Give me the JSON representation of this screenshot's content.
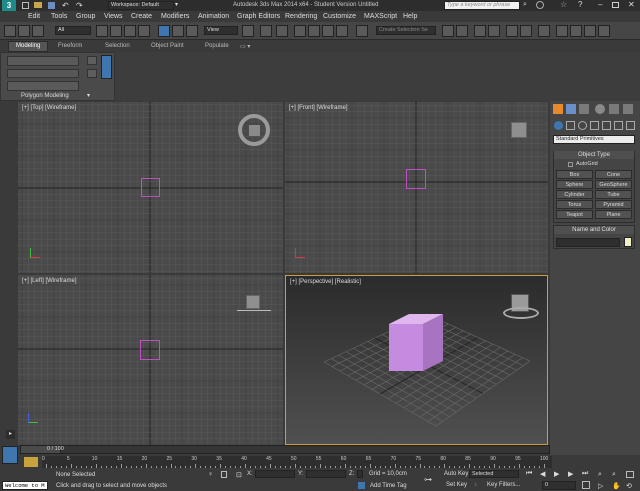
{
  "titlebar": {
    "workspace": "Workspace: Default",
    "title": "Autodesk 3ds Max 2014 x64  -  Student Version   Untitled",
    "search_placeholder": "Type a keyword or phrase"
  },
  "menu": [
    "Edit",
    "Tools",
    "Group",
    "Views",
    "Create",
    "Modifiers",
    "Animation",
    "Graph Editors",
    "Rendering",
    "Customize",
    "MAXScript",
    "Help"
  ],
  "toolbar": {
    "filter": "All",
    "ref_coord": "View",
    "selection_set": "Create Selection Se"
  },
  "ribbon": {
    "tabs": [
      "Modeling",
      "Freeform",
      "Selection",
      "Object Paint",
      "Populate"
    ],
    "active_tab": "Modeling",
    "panel_label": "Polygon Modeling"
  },
  "viewports": [
    {
      "label": "[+] [Top] [Wireframe]"
    },
    {
      "label": "[+] [Front] [Wireframe]"
    },
    {
      "label": "[+] [Left] [Wireframe]"
    },
    {
      "label": "[+] [Perspective] [Realistic]"
    }
  ],
  "command_panel": {
    "dropdown": "Standard Primitives",
    "object_type_title": "Object Type",
    "autogrid": "AutoGrid",
    "primitives": [
      "Box",
      "Cone",
      "Sphere",
      "GeoSphere",
      "Cylinder",
      "Tube",
      "Torus",
      "Pyramid",
      "Teapot",
      "Plane"
    ],
    "name_color_title": "Name and Color"
  },
  "timeline": {
    "frame_display": "0 / 100",
    "ticks": [
      "0",
      "5",
      "10",
      "15",
      "20",
      "25",
      "30",
      "35",
      "40",
      "45",
      "50",
      "55",
      "60",
      "65",
      "70",
      "75",
      "80",
      "85",
      "90",
      "95",
      "100"
    ]
  },
  "status": {
    "maxscript": "Welcome to M",
    "selection": "None Selected",
    "prompt": "Click and drag to select and move objects",
    "x_label": "X:",
    "y_label": "Y:",
    "z_label": "Z:",
    "grid": "Grid = 10,0cm",
    "add_time_tag": "Add Time Tag",
    "auto_key": "Auto Key",
    "selected": "Selected",
    "set_key": "Set Key",
    "key_filters": "Key Filters...",
    "frame": "0"
  },
  "colors": {
    "accent": "#3f76b0",
    "box": "#c58be0",
    "box_outline": "#c050c0",
    "active_border": "#c8a040"
  }
}
